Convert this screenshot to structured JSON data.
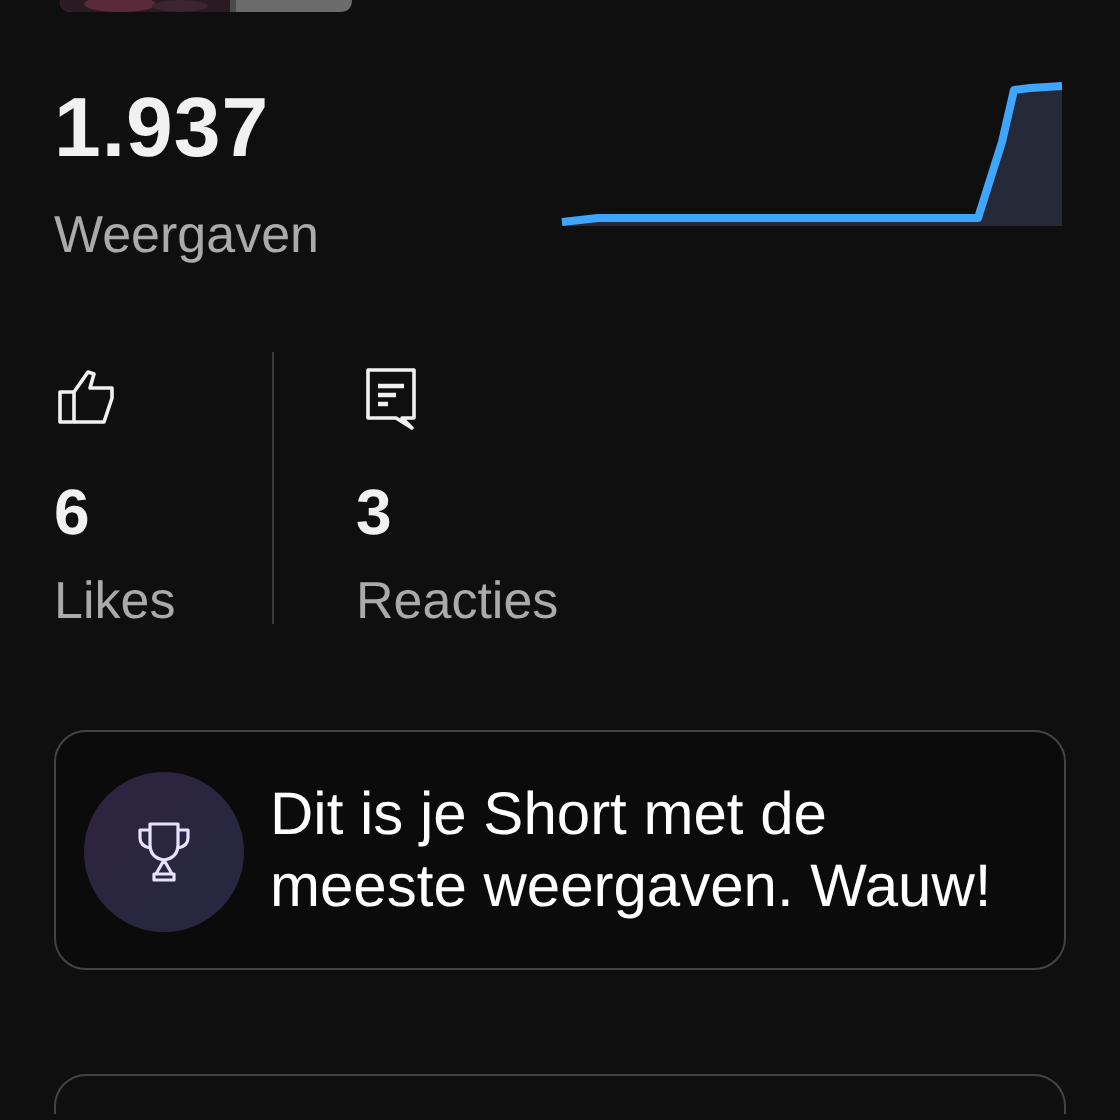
{
  "views": {
    "value": "1.937",
    "label": "Weergaven"
  },
  "stats": [
    {
      "kind": "likes",
      "value": "6",
      "label": "Likes"
    },
    {
      "kind": "comments",
      "value": "3",
      "label": "Reacties"
    }
  ],
  "highlight": {
    "text": "Dit is je Short met de meeste weergaven. Wauw!"
  }
}
